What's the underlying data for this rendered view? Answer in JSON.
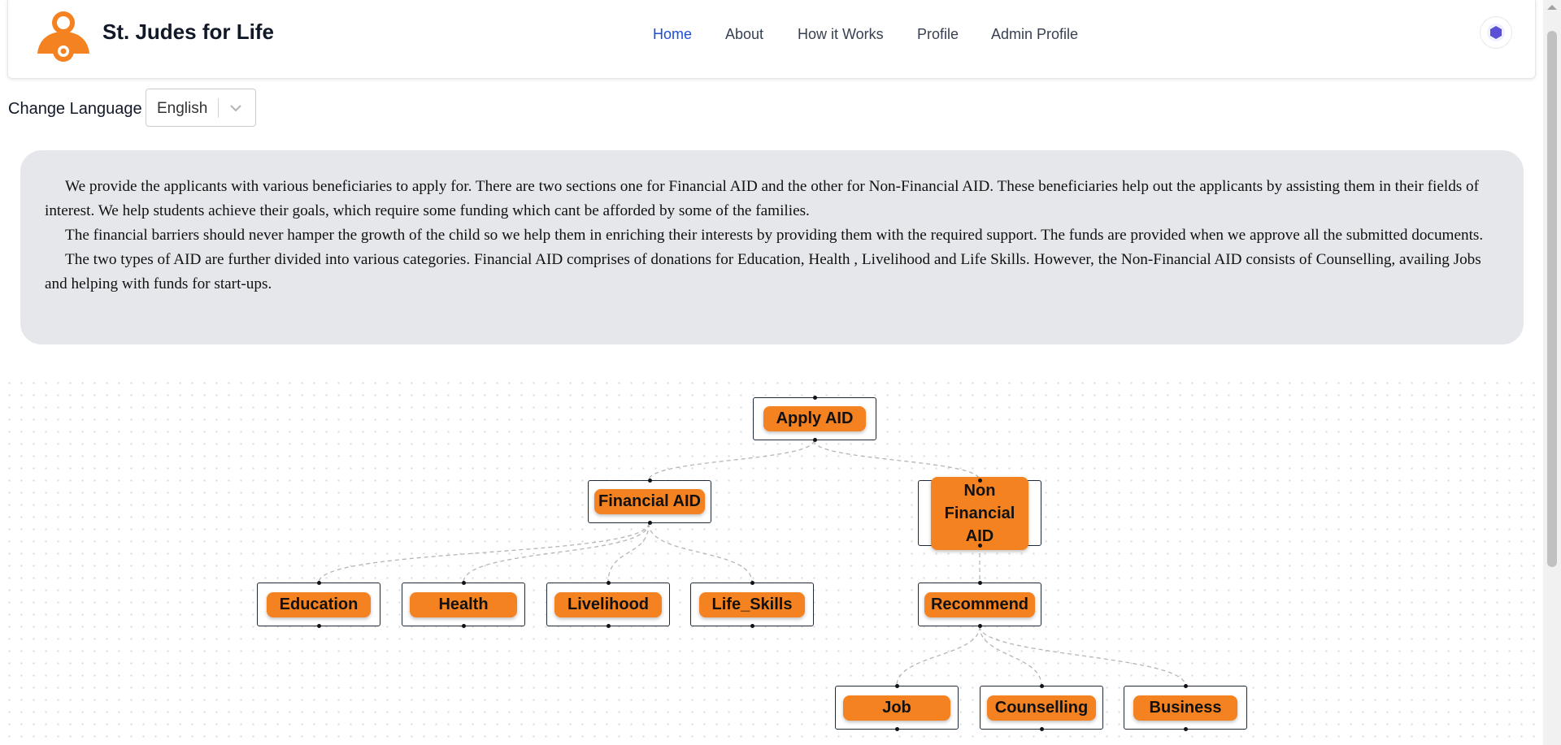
{
  "app": {
    "brand": "St. Judes for Life",
    "accent": "#f58220"
  },
  "nav": {
    "items": [
      "Home",
      "About",
      "How it Works",
      "Profile",
      "Admin Profile"
    ],
    "active": "Home"
  },
  "language": {
    "label": "Change Language",
    "value": "English"
  },
  "info": {
    "paragraphs": [
      "We provide the applicants with various beneficiaries to apply for. There are two sections one for Financial AID and the other for Non-Financial AID. These beneficiaries help out the applicants by assisting them in their fields of interest. We help students achieve their goals, which require some funding which cant be afforded by some of the families.",
      "The financial barriers should never hamper the growth of the child so we help them in enriching their interests by providing them with the required support. The funds are provided when we approve all the submitted documents.",
      "The two types of AID are further divided into various categories. Financial AID comprises of donations for Education, Health , Livelihood and Life Skills. However, the Non-Financial AID consists of Counselling, availing Jobs and helping with funds for start-ups."
    ]
  },
  "flow": {
    "nodes": {
      "apply_aid": "Apply AID",
      "financial_aid": "Financial AID",
      "non_financial_aid": "Non Financial AID",
      "education": "Education",
      "health": "Health",
      "livelihood": "Livelihood",
      "life_skills": "Life_Skills",
      "recommend": "Recommend",
      "job": "Job",
      "counselling": "Counselling",
      "business": "Business"
    }
  }
}
